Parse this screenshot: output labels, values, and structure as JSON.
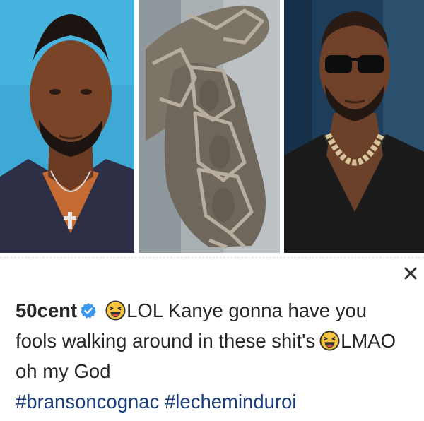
{
  "photos": [
    {
      "subject": "50 Cent portrait",
      "background": "#3fa9d6"
    },
    {
      "subject": "knitted sock boots with rubber straps",
      "background": "#a9b0b4"
    },
    {
      "subject": "Kanye West portrait",
      "background": "#1e3d5a"
    }
  ],
  "post": {
    "username": "50cent",
    "verified": true,
    "line1_text": "LOL Kanye gonna have you fools walking around in these shit's",
    "line2_text": "LMAO oh my God",
    "hashtags": [
      "#bransoncognac",
      "#lecheminduroi"
    ]
  },
  "icons": {
    "close": "close-icon",
    "verified": "verified-badge-icon",
    "emoji": "laughing-face-emoji-icon"
  },
  "colors": {
    "verified": "#3897f0",
    "hashtag": "#1a3f7a",
    "text": "#262626",
    "emoji_fill": "#f7c53d"
  }
}
